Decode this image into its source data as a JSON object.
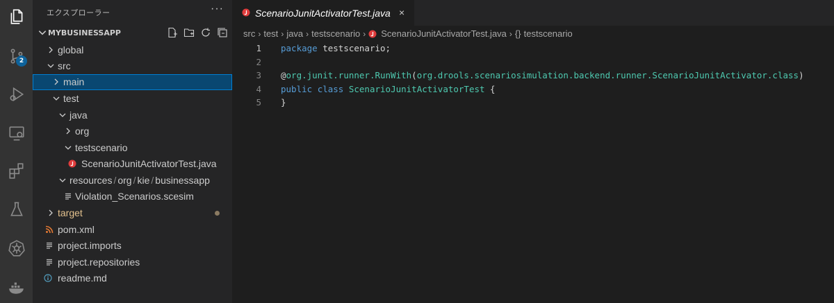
{
  "activity_bar": {
    "items": [
      {
        "icon": "files-icon"
      },
      {
        "icon": "source-control-icon",
        "badge": "2"
      },
      {
        "icon": "run-debug-icon"
      },
      {
        "icon": "remote-explorer-icon"
      },
      {
        "icon": "extensions-icon"
      },
      {
        "icon": "testing-icon"
      },
      {
        "icon": "kubernetes-icon"
      },
      {
        "icon": "docker-icon"
      }
    ]
  },
  "sidebar": {
    "title": "エクスプローラー",
    "more": "···",
    "project": "MYBUSINESSAPP",
    "tree": [
      {
        "label": "global",
        "type": "folder",
        "expanded": false
      },
      {
        "label": "src",
        "type": "folder",
        "expanded": true
      },
      {
        "label": "main",
        "type": "folder",
        "expanded": false,
        "selected": true
      },
      {
        "label": "test",
        "type": "folder",
        "expanded": true
      },
      {
        "label": "java",
        "type": "folder",
        "expanded": true
      },
      {
        "label": "org",
        "type": "folder",
        "expanded": false
      },
      {
        "label": "testscenario",
        "type": "folder",
        "expanded": true
      },
      {
        "label": "ScenarioJunitActivatorTest.java",
        "type": "java"
      },
      {
        "label_parts": [
          "resources",
          "org",
          "kie",
          "businessapp"
        ],
        "type": "folder",
        "expanded": true
      },
      {
        "label": "Violation_Scenarios.scesim",
        "type": "text"
      },
      {
        "label": "target",
        "type": "folder",
        "expanded": false,
        "modified": true
      },
      {
        "label": "pom.xml",
        "type": "rss"
      },
      {
        "label": "project.imports",
        "type": "text"
      },
      {
        "label": "project.repositories",
        "type": "text"
      },
      {
        "label": "readme.md",
        "type": "info"
      }
    ]
  },
  "editor": {
    "tab": {
      "label": "ScenarioJunitActivatorTest.java",
      "close": "×"
    },
    "breadcrumb": [
      "src",
      "test",
      "java",
      "testscenario",
      "ScenarioJunitActivatorTest.java",
      "testscenario"
    ],
    "breadcrumb_braces": "{}",
    "lines": [
      {
        "n": "1",
        "parts": [
          {
            "t": "package",
            "c": "kw"
          },
          {
            "t": " testscenario;",
            "c": "plain"
          }
        ]
      },
      {
        "n": "2",
        "parts": []
      },
      {
        "n": "3",
        "parts": [
          {
            "t": "@",
            "c": "ann"
          },
          {
            "t": "org.junit.runner.RunWith",
            "c": "pk"
          },
          {
            "t": "(",
            "c": "plain"
          },
          {
            "t": "org.drools.scenariosimulation.backend.runner.ScenarioJunitActivator.class",
            "c": "pk"
          },
          {
            "t": ")",
            "c": "plain"
          }
        ]
      },
      {
        "n": "4",
        "parts": [
          {
            "t": "public",
            "c": "kw"
          },
          {
            "t": " ",
            "c": "plain"
          },
          {
            "t": "class",
            "c": "kw"
          },
          {
            "t": " ",
            "c": "plain"
          },
          {
            "t": "ScenarioJunitActivatorTest",
            "c": "cls"
          },
          {
            "t": " {",
            "c": "plain"
          }
        ]
      },
      {
        "n": "5",
        "parts": [
          {
            "t": "}",
            "c": "plain"
          }
        ]
      }
    ]
  },
  "colors": {
    "java_icon": "#e03c3c",
    "rss_icon": "#e37933",
    "info_icon": "#519aba",
    "selection": "#094771"
  }
}
